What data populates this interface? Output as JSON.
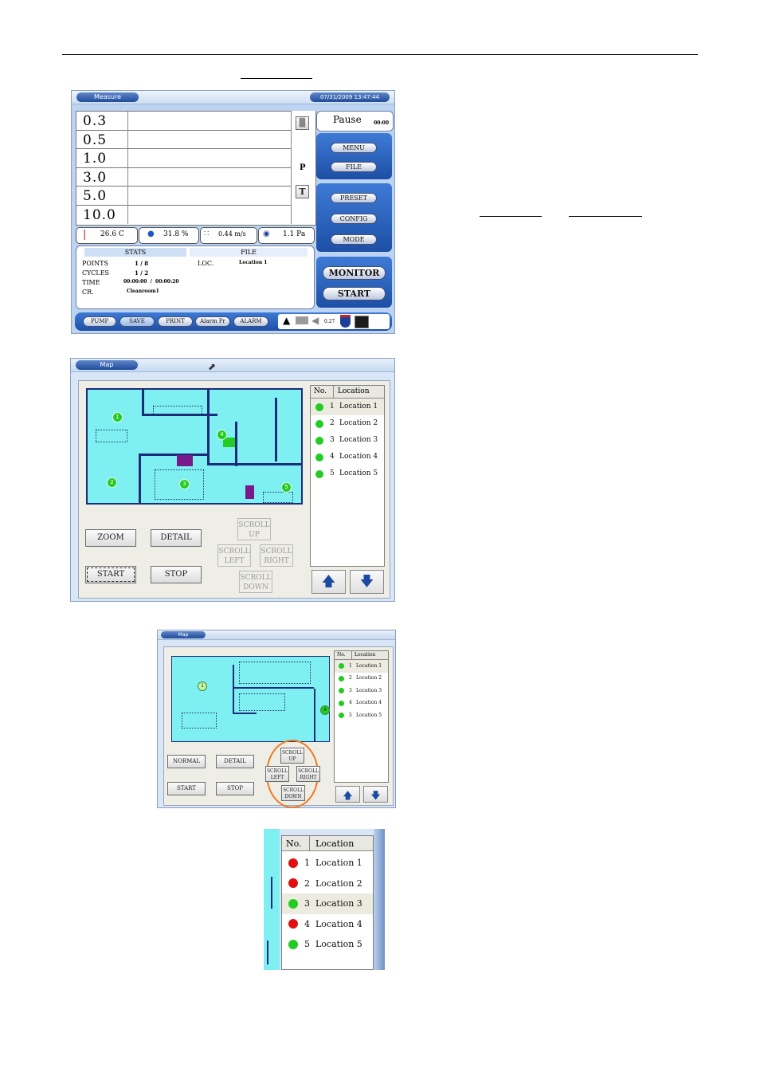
{
  "measure": {
    "title": "Measure",
    "datetime": "07/31/2009 13:47:44",
    "sizes": [
      "0.3",
      "0.5",
      "1.0",
      "3.0",
      "5.0",
      "10.0"
    ],
    "side_letters": {
      "p": "P",
      "t": "T"
    },
    "pause_label": "Pause",
    "pause_time": "00:00",
    "menu_buttons": [
      "MENU",
      "FILE"
    ],
    "config_buttons": [
      "PRESET",
      "CONFIG",
      "MODE"
    ],
    "monitor_label": "MONITOR",
    "start_label": "START",
    "env": {
      "temp": "26.6 C",
      "humidity": "31.8 %",
      "velocity": "0.44 m/s",
      "pressure": "1.1 Pa"
    },
    "tabs": {
      "stats": "STATS",
      "file": "FILE"
    },
    "stats": {
      "points_label": "POINTS",
      "points": "1 / 8",
      "cycles_label": "CYCLES",
      "cycles": "1 / 2",
      "time_label": "TIME",
      "time": "00:00:00  /  00:00:20",
      "cr_label": "CR.",
      "cr": "Cleanroom1",
      "loc_label": "LOC.",
      "loc": "Location 1"
    },
    "bottom_buttons": [
      "PUMP",
      "SAVE",
      "PRINT",
      "Alarm Pr",
      "ALARM"
    ],
    "status_number": "0.27"
  },
  "map1": {
    "title": "Map",
    "buttons": {
      "zoom": "ZOOM",
      "detail": "DETAIL",
      "start": "START",
      "stop": "STOP"
    },
    "scroll": {
      "up": [
        "SCROLL",
        "UP"
      ],
      "left": [
        "SCROLL",
        "LEFT"
      ],
      "right": [
        "SCROLL",
        "RIGHT"
      ],
      "down": [
        "SCROLL",
        "DOWN"
      ]
    },
    "list_header": {
      "no": "No.",
      "location": "Location"
    },
    "locations": [
      {
        "no": "1",
        "name": "Location 1",
        "color": "#22cc22"
      },
      {
        "no": "2",
        "name": "Location 2",
        "color": "#22cc22"
      },
      {
        "no": "3",
        "name": "Location 3",
        "color": "#22cc22"
      },
      {
        "no": "4",
        "name": "Location 4",
        "color": "#22cc22"
      },
      {
        "no": "5",
        "name": "Location 5",
        "color": "#22cc22"
      }
    ],
    "markers": [
      "1",
      "2",
      "3",
      "4",
      "5"
    ]
  },
  "map2": {
    "title": "Map",
    "buttons": {
      "normal": "NORMAL",
      "detail": "DETAIL",
      "start": "START",
      "stop": "STOP"
    },
    "scroll": {
      "up": [
        "SCROLL",
        "UP"
      ],
      "left": [
        "SCROLL",
        "LEFT"
      ],
      "right": [
        "SCROLL",
        "RIGHT"
      ],
      "down": [
        "SCROLL",
        "DOWN"
      ]
    },
    "list_header": {
      "no": "No.",
      "location": "Location"
    },
    "locations": [
      {
        "no": "1",
        "name": "Location 1",
        "color": "#22cc22"
      },
      {
        "no": "2",
        "name": "Location 2",
        "color": "#22cc22"
      },
      {
        "no": "3",
        "name": "Location 3",
        "color": "#22cc22"
      },
      {
        "no": "4",
        "name": "Location 4",
        "color": "#22cc22"
      },
      {
        "no": "5",
        "name": "Location 5",
        "color": "#22cc22"
      }
    ],
    "markers": [
      "1",
      "4"
    ],
    "highlight_color": "#f07820"
  },
  "status_list": {
    "header": {
      "no": "No.",
      "location": "Location"
    },
    "locations": [
      {
        "no": "1",
        "name": "Location 1",
        "color": "#e01010"
      },
      {
        "no": "2",
        "name": "Location 2",
        "color": "#e01010"
      },
      {
        "no": "3",
        "name": "Location 3",
        "color": "#22cc22"
      },
      {
        "no": "4",
        "name": "Location 4",
        "color": "#e01010"
      },
      {
        "no": "5",
        "name": "Location 5",
        "color": "#22cc22"
      }
    ]
  }
}
